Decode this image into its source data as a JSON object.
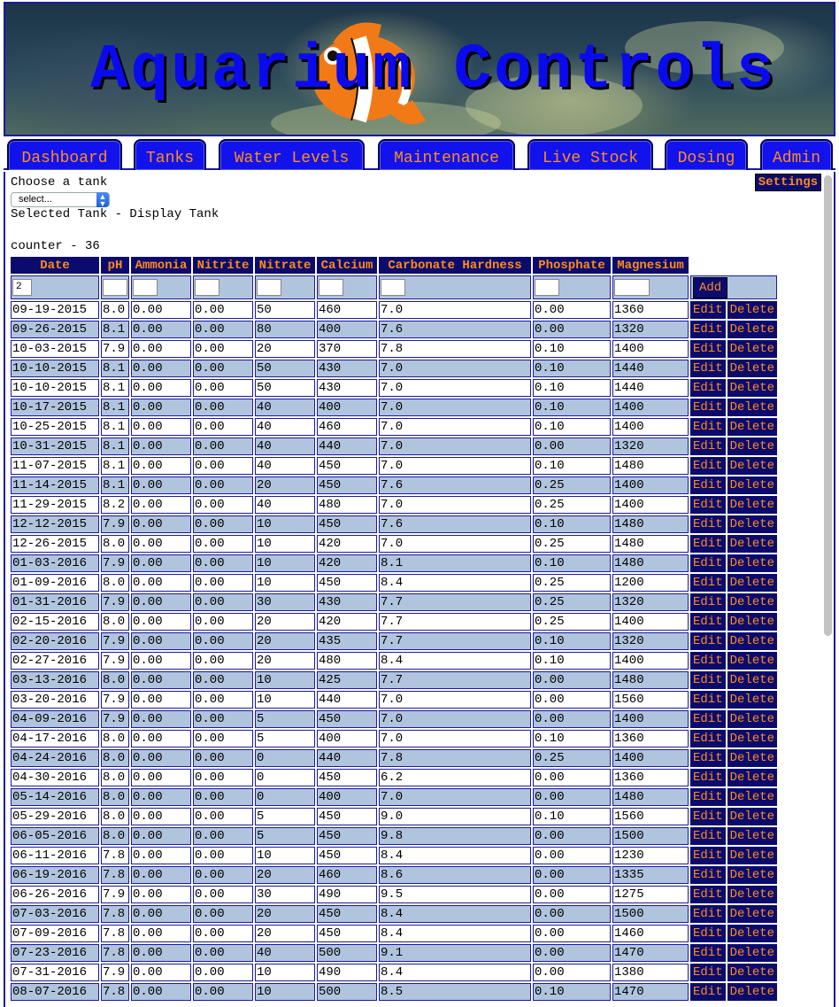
{
  "banner": {
    "title": "Aquarium Controls"
  },
  "nav": {
    "tabs": [
      "Dashboard",
      "Tanks",
      "Water Levels",
      "Maintenance",
      "Live Stock",
      "Dosing",
      "Admin"
    ]
  },
  "page": {
    "choose_label": "Choose a tank",
    "select_value": "select...",
    "selected_tank": "Selected Tank - Display Tank",
    "counter": "counter - 36",
    "settings_label": "Settings"
  },
  "table": {
    "columns": [
      "Date",
      "pH",
      "Ammonia",
      "Nitrite",
      "Nitrate",
      "Calcium",
      "Carbonate Hardness",
      "Phosphate",
      "Magnesium"
    ],
    "add_row_date_value": "2",
    "add_label": "Add",
    "edit_label": "Edit",
    "delete_label": "Delete",
    "rows": [
      [
        "09-19-2015",
        "8.0",
        "0.00",
        "0.00",
        "50",
        "460",
        "7.0",
        "0.00",
        "1360"
      ],
      [
        "09-26-2015",
        "8.1",
        "0.00",
        "0.00",
        "80",
        "400",
        "7.6",
        "0.00",
        "1320"
      ],
      [
        "10-03-2015",
        "7.9",
        "0.00",
        "0.00",
        "20",
        "370",
        "7.8",
        "0.10",
        "1400"
      ],
      [
        "10-10-2015",
        "8.1",
        "0.00",
        "0.00",
        "50",
        "430",
        "7.0",
        "0.10",
        "1440"
      ],
      [
        "10-10-2015",
        "8.1",
        "0.00",
        "0.00",
        "50",
        "430",
        "7.0",
        "0.10",
        "1440"
      ],
      [
        "10-17-2015",
        "8.1",
        "0.00",
        "0.00",
        "40",
        "400",
        "7.0",
        "0.10",
        "1400"
      ],
      [
        "10-25-2015",
        "8.1",
        "0.00",
        "0.00",
        "40",
        "460",
        "7.0",
        "0.10",
        "1400"
      ],
      [
        "10-31-2015",
        "8.1",
        "0.00",
        "0.00",
        "40",
        "440",
        "7.0",
        "0.00",
        "1320"
      ],
      [
        "11-07-2015",
        "8.1",
        "0.00",
        "0.00",
        "40",
        "450",
        "7.0",
        "0.10",
        "1480"
      ],
      [
        "11-14-2015",
        "8.1",
        "0.00",
        "0.00",
        "20",
        "450",
        "7.6",
        "0.25",
        "1400"
      ],
      [
        "11-29-2015",
        "8.2",
        "0.00",
        "0.00",
        "40",
        "480",
        "7.0",
        "0.25",
        "1400"
      ],
      [
        "12-12-2015",
        "7.9",
        "0.00",
        "0.00",
        "10",
        "450",
        "7.6",
        "0.10",
        "1480"
      ],
      [
        "12-26-2015",
        "8.0",
        "0.00",
        "0.00",
        "10",
        "420",
        "7.0",
        "0.25",
        "1480"
      ],
      [
        "01-03-2016",
        "7.9",
        "0.00",
        "0.00",
        "10",
        "420",
        "8.1",
        "0.10",
        "1480"
      ],
      [
        "01-09-2016",
        "8.0",
        "0.00",
        "0.00",
        "10",
        "450",
        "8.4",
        "0.25",
        "1200"
      ],
      [
        "01-31-2016",
        "7.9",
        "0.00",
        "0.00",
        "30",
        "430",
        "7.7",
        "0.25",
        "1320"
      ],
      [
        "02-15-2016",
        "8.0",
        "0.00",
        "0.00",
        "20",
        "420",
        "7.7",
        "0.25",
        "1400"
      ],
      [
        "02-20-2016",
        "7.9",
        "0.00",
        "0.00",
        "20",
        "435",
        "7.7",
        "0.10",
        "1320"
      ],
      [
        "02-27-2016",
        "7.9",
        "0.00",
        "0.00",
        "20",
        "480",
        "8.4",
        "0.10",
        "1400"
      ],
      [
        "03-13-2016",
        "8.0",
        "0.00",
        "0.00",
        "10",
        "425",
        "7.7",
        "0.00",
        "1480"
      ],
      [
        "03-20-2016",
        "7.9",
        "0.00",
        "0.00",
        "10",
        "440",
        "7.0",
        "0.00",
        "1560"
      ],
      [
        "04-09-2016",
        "7.9",
        "0.00",
        "0.00",
        "5",
        "450",
        "7.0",
        "0.00",
        "1400"
      ],
      [
        "04-17-2016",
        "8.0",
        "0.00",
        "0.00",
        "5",
        "400",
        "7.0",
        "0.10",
        "1360"
      ],
      [
        "04-24-2016",
        "8.0",
        "0.00",
        "0.00",
        "0",
        "440",
        "7.8",
        "0.25",
        "1400"
      ],
      [
        "04-30-2016",
        "8.0",
        "0.00",
        "0.00",
        "0",
        "450",
        "6.2",
        "0.00",
        "1360"
      ],
      [
        "05-14-2016",
        "8.0",
        "0.00",
        "0.00",
        "0",
        "400",
        "7.0",
        "0.00",
        "1480"
      ],
      [
        "05-29-2016",
        "8.0",
        "0.00",
        "0.00",
        "5",
        "450",
        "9.0",
        "0.10",
        "1560"
      ],
      [
        "06-05-2016",
        "8.0",
        "0.00",
        "0.00",
        "5",
        "450",
        "9.8",
        "0.00",
        "1500"
      ],
      [
        "06-11-2016",
        "7.8",
        "0.00",
        "0.00",
        "10",
        "450",
        "8.4",
        "0.00",
        "1230"
      ],
      [
        "06-19-2016",
        "7.8",
        "0.00",
        "0.00",
        "20",
        "460",
        "8.6",
        "0.00",
        "1335"
      ],
      [
        "06-26-2016",
        "7.9",
        "0.00",
        "0.00",
        "30",
        "490",
        "9.5",
        "0.00",
        "1275"
      ],
      [
        "07-03-2016",
        "7.8",
        "0.00",
        "0.00",
        "20",
        "450",
        "8.4",
        "0.00",
        "1500"
      ],
      [
        "07-09-2016",
        "7.8",
        "0.00",
        "0.00",
        "20",
        "450",
        "8.4",
        "0.00",
        "1460"
      ],
      [
        "07-23-2016",
        "7.8",
        "0.00",
        "0.00",
        "40",
        "500",
        "9.1",
        "0.00",
        "1470"
      ],
      [
        "07-31-2016",
        "7.9",
        "0.00",
        "0.00",
        "10",
        "490",
        "8.4",
        "0.00",
        "1380"
      ],
      [
        "08-07-2016",
        "7.8",
        "0.00",
        "0.00",
        "10",
        "500",
        "8.5",
        "0.10",
        "1470"
      ]
    ]
  },
  "colors": {
    "tab_bg": "#1212ec",
    "header_cell": "#0b0b6e",
    "accent_text": "#ff8c1a",
    "row_alt": "#b0c4de",
    "border": "#1a1a9e",
    "content_bg": "#ffffff"
  }
}
